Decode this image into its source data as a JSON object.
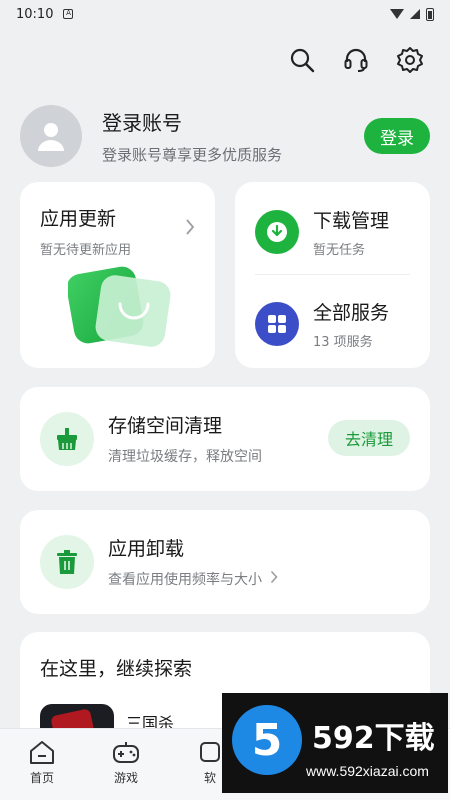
{
  "statusbar": {
    "time": "10:10",
    "notif_icon": "A"
  },
  "top_icons": [
    "search-icon",
    "headset-icon",
    "gear-icon"
  ],
  "profile": {
    "title": "登录账号",
    "subtitle": "登录账号尊享更多优质服务",
    "login_label": "登录"
  },
  "update": {
    "title": "应用更新",
    "subtitle": "暂无待更新应用"
  },
  "download": {
    "title": "下载管理",
    "subtitle": "暂无任务"
  },
  "services": {
    "title": "全部服务",
    "subtitle": "13 项服务"
  },
  "clean": {
    "title": "存储空间清理",
    "subtitle": "清理垃圾缓存，释放空间",
    "button": "去清理"
  },
  "uninstall": {
    "title": "应用卸载",
    "subtitle": "查看应用使用频率与大小"
  },
  "explore": {
    "title": "在这里，继续探索",
    "game_name": "三国杀"
  },
  "nav": [
    {
      "label": "首页",
      "icon": "home-icon"
    },
    {
      "label": "游戏",
      "icon": "gamepad-icon"
    },
    {
      "label": "软",
      "icon": "apps-icon"
    }
  ],
  "watermark": {
    "title": "592下载",
    "url": "www.592xiazai.com",
    "logo_digit": "5"
  },
  "colors": {
    "accent": "#1db33e",
    "background": "#eff0f2",
    "services_blue": "#3b4ec7"
  }
}
